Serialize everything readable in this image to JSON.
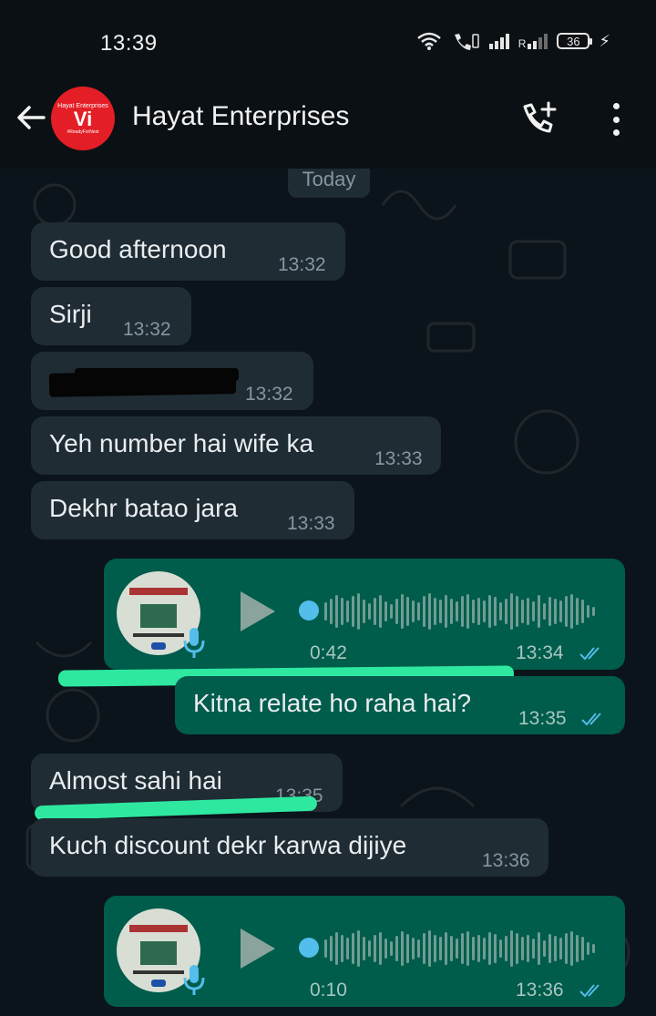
{
  "status_bar": {
    "time": "13:39",
    "battery": "36",
    "icons": [
      "wifi-icon",
      "wifi-calling-icon",
      "signal-icon",
      "roaming-signal-icon",
      "battery-icon",
      "charging-icon"
    ]
  },
  "header": {
    "contact_name": "Hayat Enterprises",
    "avatar": {
      "top_text": "Hayat Enterprises",
      "logo": "Vi",
      "tagline": "#ReadyForNext",
      "color": "#e41e26"
    }
  },
  "chat": {
    "date_chip": "Today",
    "messages": [
      {
        "dir": "in",
        "text": "Good afternoon",
        "time": "13:32"
      },
      {
        "dir": "in",
        "text": "Sirji",
        "time": "13:32"
      },
      {
        "dir": "in",
        "text": "",
        "time": "13:32",
        "note": "redacted"
      },
      {
        "dir": "in",
        "text": "Yeh number hai wife ka",
        "time": "13:33"
      },
      {
        "dir": "in",
        "text": "Dekhr batao jara",
        "time": "13:33"
      },
      {
        "dir": "out",
        "type": "voice",
        "duration": "0:42",
        "time": "13:34",
        "status": "read"
      },
      {
        "dir": "out",
        "text": "Kitna relate ho raha hai?",
        "time": "13:35",
        "status": "read"
      },
      {
        "dir": "in",
        "text": "Almost sahi hai",
        "time": "13:35"
      },
      {
        "dir": "in",
        "text": "Kuch discount dekr karwa dijiye",
        "time": "13:36"
      },
      {
        "dir": "out",
        "type": "voice",
        "duration": "0:10",
        "time": "13:36",
        "status": "read"
      }
    ]
  },
  "colors": {
    "incoming_bubble": "#1f2c34",
    "outgoing_bubble": "#005c4b",
    "read_ticks": "#53bdeb",
    "highlight": "#2ee8a0"
  }
}
